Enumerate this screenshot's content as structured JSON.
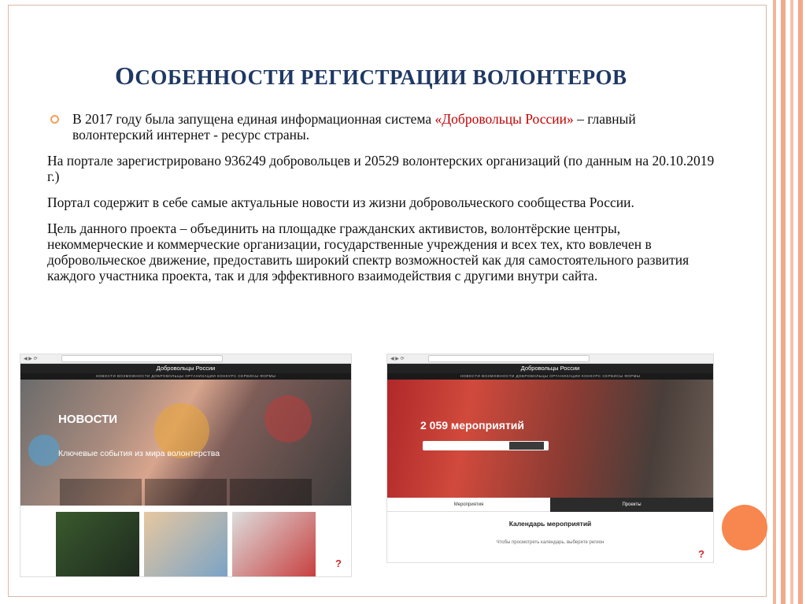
{
  "title": {
    "first_letter": "О",
    "rest": "собенности регистрации волонтеров"
  },
  "paragraphs": {
    "p1_before": "В 2017 году была запущена единая информационная система ",
    "p1_highlight": "«Добровольцы России»",
    "p1_after": " – главный волонтерский интернет - ресурс страны.",
    "p2": "На портале зарегистрировано 936249 добровольцев и 20529  волонтерских организаций (по данным на 20.10.2019 г.)",
    "p3": "Портал содержит в себе самые актуальные новости из жизни добровольческого сообщества России.",
    "p4": "Цель данного проекта – объединить на площадке гражданских активистов, волонтёрские центры, некоммерческие и коммерческие организации, государственные учреждения и всех тех, кто вовлечен в добровольческое движение, предоставить широкий спектр возможностей как для самостоятельного развития каждого участника проекта, так и для эффективного взаимодействия с другими внутри сайта."
  },
  "screenshot_left": {
    "site_title": "Добровольцы России",
    "nav": "НОВОСТИ   ВОЗМОЖНОСТИ   ДОБРОВОЛЬЦЫ   ОРГАНИЗАЦИИ   КОНКУРС   СЕРВИСЫ   ФОРМЫ",
    "hero_label": "НОВОСТИ",
    "hero_sub": "Ключевые события из мира волонтерства"
  },
  "screenshot_right": {
    "site_title": "Добровольцы России",
    "nav": "НОВОСТИ   ВОЗМОЖНОСТИ   ДОБРОВОЛЬЦЫ   ОРГАНИЗАЦИИ   КОНКУРС   СЕРВИСЫ   ФОРМЫ",
    "events_count": "2 059 мероприятий",
    "tab_events": "Мероприятия",
    "tab_projects": "Проекты",
    "calendar_title": "Календарь мероприятий",
    "calendar_hint": "Чтобы просмотреть календарь, выберите регион"
  },
  "help_symbol": "?",
  "colors": {
    "title": "#1f3864",
    "highlight": "#c00000",
    "bullet": "#f3a05a",
    "accent_circle": "#f7874e"
  }
}
